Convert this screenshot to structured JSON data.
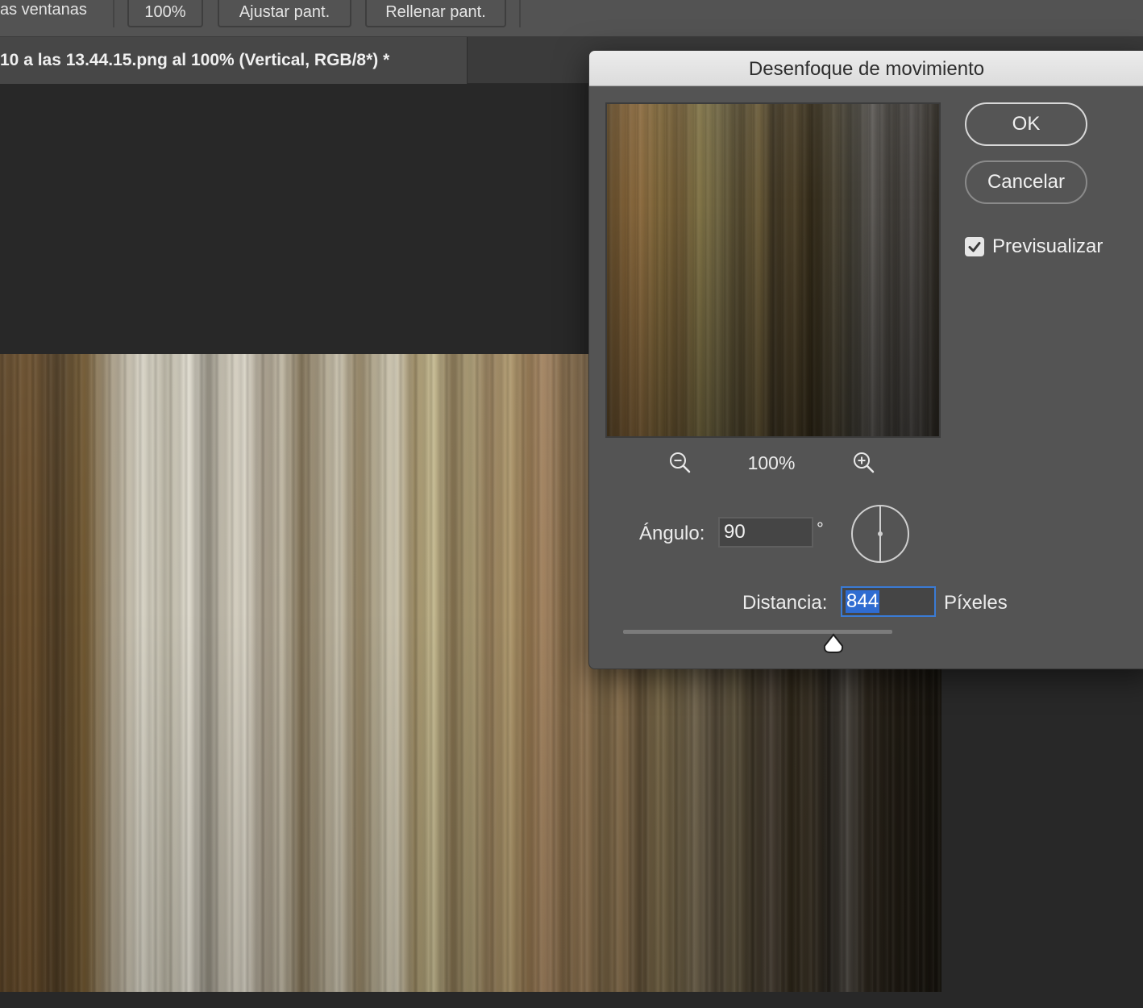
{
  "options_bar": {
    "partial_label": "as ventanas",
    "buttons": [
      "100%",
      "Ajustar pant.",
      "Rellenar pant."
    ]
  },
  "document_tab": {
    "title": "10 a las 13.44.15.png al 100% (Vertical, RGB/8*) *"
  },
  "dialog": {
    "title": "Desenfoque de movimiento",
    "ok_label": "OK",
    "cancel_label": "Cancelar",
    "preview": {
      "label": "Previsualizar",
      "checked": true
    },
    "zoom": {
      "level": "100%",
      "zoom_out_icon": "zoom-out-icon",
      "zoom_in_icon": "zoom-in-icon"
    },
    "angle": {
      "label": "Ángulo:",
      "value": "90",
      "unit": "°"
    },
    "distance": {
      "label": "Distancia:",
      "value": "844",
      "unit": "Píxeles",
      "slider_fraction": 0.78
    }
  },
  "colors": {
    "selection": "#2f6cd1",
    "dialog_bg": "#545454",
    "titlebar_bg": "#e4e4e4",
    "canvas_bg": "#282828"
  }
}
